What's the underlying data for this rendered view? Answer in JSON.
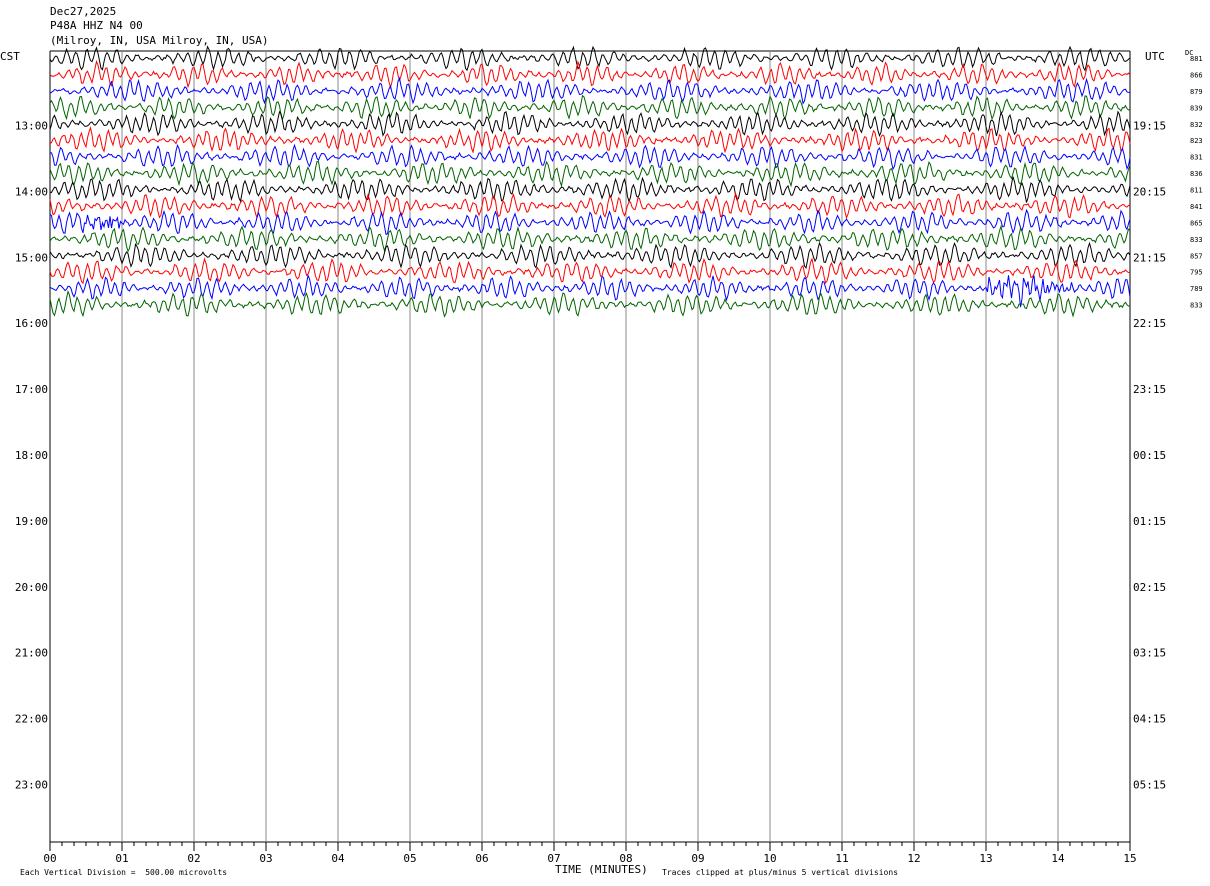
{
  "header": {
    "date": "Dec27,2025",
    "station": "P48A HHZ N4 00",
    "location": "(Milroy, IN, USA Milroy, IN, USA)"
  },
  "left_tz": "CST",
  "right_tz": "UTC",
  "dc_label": "DC",
  "footer": {
    "left": "Each Vertical Division =  500.00 microvolts",
    "right": "Traces clipped at plus/minus 5 vertical divisions"
  },
  "chart_data": {
    "type": "line",
    "title": "",
    "xlabel": "TIME (MINUTES)",
    "ylabel": "",
    "x_ticks": [
      "00",
      "01",
      "02",
      "03",
      "04",
      "05",
      "06",
      "07",
      "08",
      "09",
      "10",
      "11",
      "12",
      "13",
      "14",
      "15"
    ],
    "xlim": [
      0,
      15
    ],
    "left_hour_labels": [
      "13:00",
      "14:00",
      "15:00",
      "16:00",
      "17:00",
      "18:00",
      "19:00",
      "20:00",
      "21:00",
      "22:00",
      "23:00"
    ],
    "right_hour_labels": [
      "19:15",
      "20:15",
      "21:15",
      "22:15",
      "23:15",
      "00:15",
      "01:15",
      "02:15",
      "03:15",
      "04:15",
      "05:15"
    ],
    "dc_offsets": [
      "881",
      "866",
      "879",
      "839",
      "832",
      "823",
      "831",
      "836",
      "811",
      "841",
      "865",
      "833",
      "857",
      "795",
      "789",
      "833"
    ],
    "trace_colors": [
      "#000000",
      "#ff0000",
      "#0000ff",
      "#006400"
    ],
    "trace_count": 16,
    "trace_minutes": 15
  }
}
